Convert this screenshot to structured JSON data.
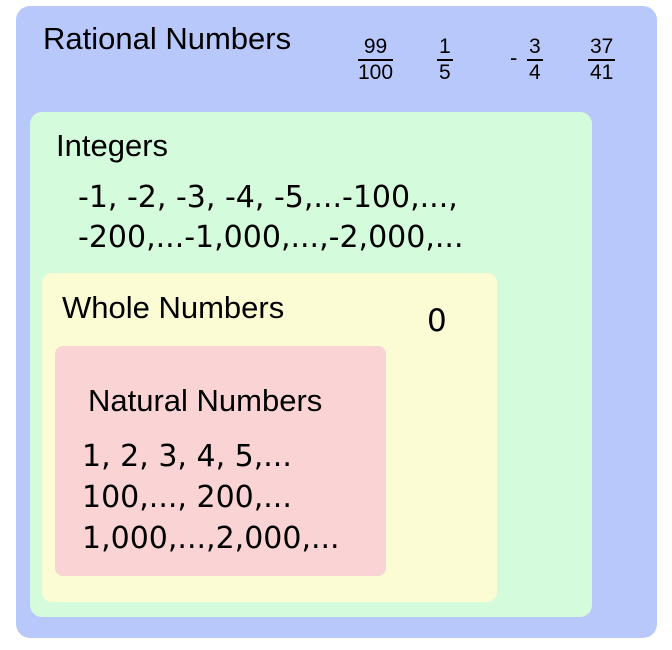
{
  "colors": {
    "rational_fill": "#b8c8fb",
    "integers_fill": "#d4fbdc",
    "whole_fill": "#fcfcd4",
    "natural_fill": "#fad4d4"
  },
  "rational": {
    "title": "Rational Numbers",
    "fractions": [
      {
        "sign": "",
        "numerator": "99",
        "denominator": "100"
      },
      {
        "sign": "",
        "numerator": "1",
        "denominator": "5"
      },
      {
        "sign": "-",
        "numerator": "3",
        "denominator": "4"
      },
      {
        "sign": "",
        "numerator": "37",
        "denominator": "41"
      }
    ]
  },
  "integers": {
    "title": "Integers",
    "lines": [
      "-1, -2, -3, -4, -5,...-100,...,",
      "-200,...-1,000,...,-2,000,..."
    ]
  },
  "whole": {
    "title": "Whole Numbers",
    "zero": "0"
  },
  "natural": {
    "title": "Natural Numbers",
    "lines": [
      "1, 2, 3, 4, 5,...",
      "100,..., 200,...",
      "1,000,...,2,000,..."
    ]
  }
}
